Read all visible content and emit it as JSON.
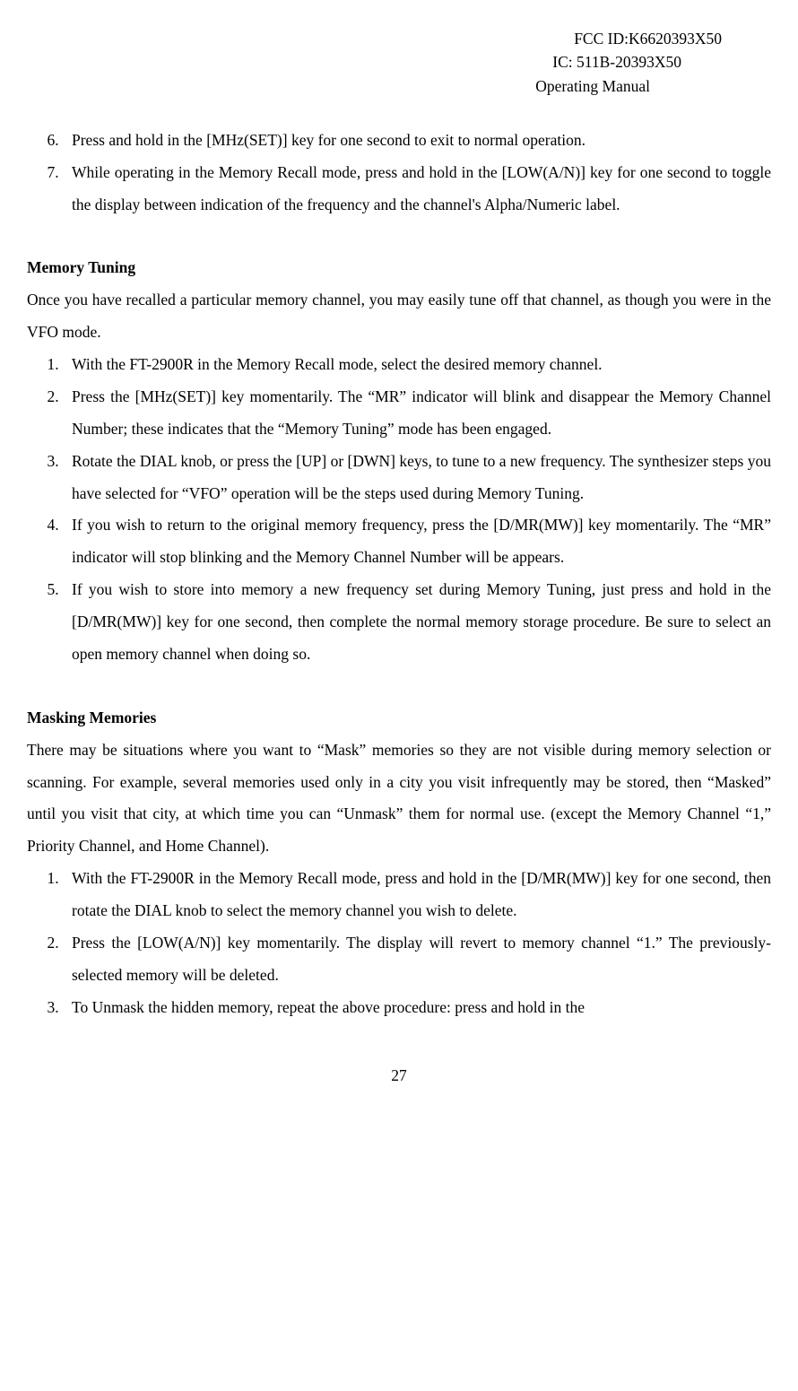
{
  "header": {
    "fcc": "FCC ID:K6620393X50",
    "ic": "IC: 511B-20393X50",
    "title": "Operating Manual"
  },
  "list1": {
    "start": 6,
    "items": [
      "Press and hold in the [MHz(SET)] key for one second to exit to normal operation.",
      "While operating in the Memory Recall mode, press and hold in the [LOW(A/N)] key for one second to toggle the display between indication of the frequency and the channel's Alpha/Numeric label."
    ]
  },
  "section1": {
    "heading": "Memory Tuning",
    "intro": "Once you have recalled a particular memory channel, you may easily tune off that channel, as though you were in the VFO mode.",
    "items": [
      "With the FT-2900R in the Memory Recall mode, select the desired memory channel.",
      "Press the [MHz(SET)] key momentarily. The “MR” indicator will blink and disappear the Memory Channel Number; these indicates that the “Memory Tuning” mode has been engaged.",
      "Rotate the DIAL knob, or press the [UP] or [DWN] keys, to tune to a new frequency. The synthesizer steps you have selected for “VFO” operation will be the steps used during Memory Tuning.",
      "If you wish to return to the original memory frequency, press the [D/MR(MW)] key momentarily. The “MR” indicator will stop blinking and the Memory Channel Number will be appears.",
      "If you wish to store into memory a new frequency set during Memory Tuning, just press and hold in the [D/MR(MW)] key for one second, then complete the normal memory storage procedure. Be sure to select an open memory channel when doing so."
    ]
  },
  "section2": {
    "heading": "Masking Memories",
    "intro": "There may be situations where you want to “Mask” memories so they are not visible during memory selection or scanning. For example, several memories used only in a city you visit infrequently may be stored, then “Masked” until you visit that city, at which time you can “Unmask” them for normal use. (except the Memory Channel “1,” Priority Channel, and Home Channel).",
    "items": [
      "With the FT-2900R in the Memory Recall mode, press and hold in the [D/MR(MW)] key for one second, then rotate the DIAL knob to select the memory channel you wish to delete.",
      "Press the [LOW(A/N)] key momentarily. The display will revert to memory channel “1.” The previously-selected memory will be deleted.",
      "To Unmask the hidden memory, repeat the above procedure: press and hold in the"
    ]
  },
  "pageNumber": "27"
}
